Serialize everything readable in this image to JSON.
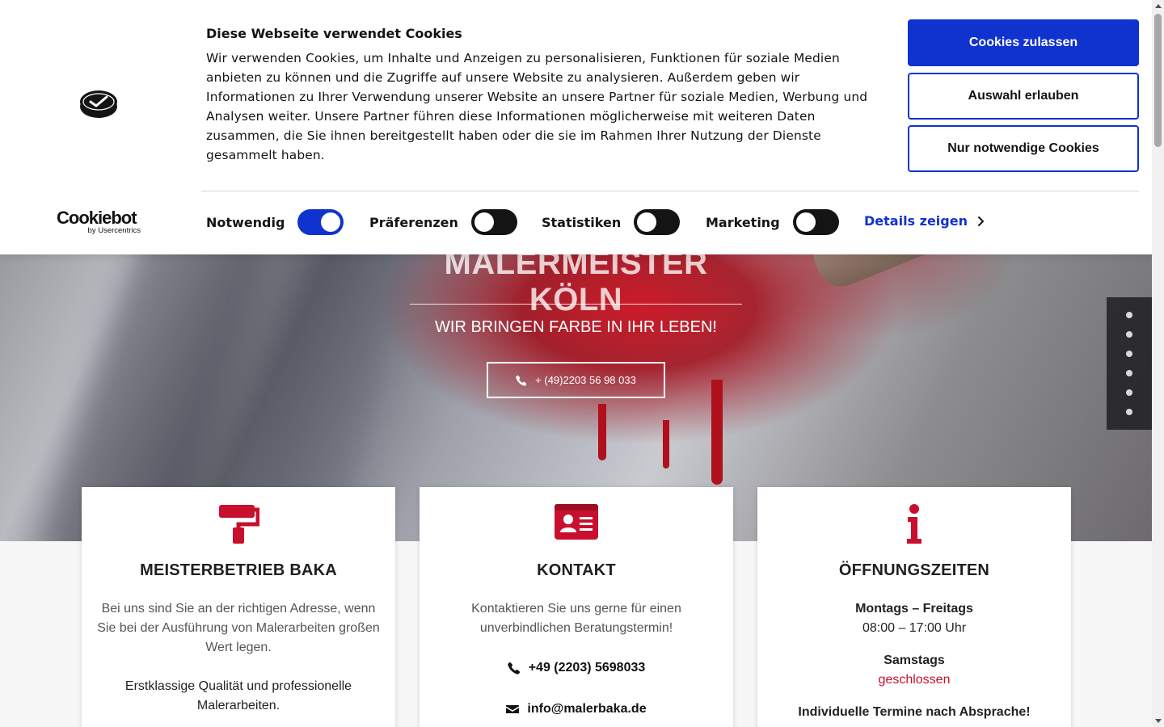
{
  "cookie_banner": {
    "heading": "Diese Webseite verwendet Cookies",
    "text": "Wir verwenden Cookies, um Inhalte und Anzeigen zu personalisieren, Funktionen für soziale Medien anbieten zu können und die Zugriffe auf unsere Website zu analysieren. Außerdem geben wir Informationen zu Ihrer Verwendung unserer Website an unsere Partner für soziale Medien, Werbung und Analysen weiter. Unsere Partner führen diese Informationen möglicherweise mit weiteren Daten zusammen, die Sie ihnen bereitgestellt haben oder die sie im Rahmen Ihrer Nutzung der Dienste gesammelt haben.",
    "brand": "Cookiebot",
    "brand_sub": "by Usercentrics",
    "buttons": {
      "allow_all": "Cookies zulassen",
      "allow_selection": "Auswahl erlauben",
      "necessary_only": "Nur notwendige Cookies"
    },
    "categories": [
      {
        "label": "Notwendig",
        "checked": true
      },
      {
        "label": "Präferenzen",
        "checked": false
      },
      {
        "label": "Statistiken",
        "checked": false
      },
      {
        "label": "Marketing",
        "checked": false
      }
    ],
    "details_link": "Details zeigen",
    "accent_color": "#1032cf"
  },
  "hero": {
    "title": "MALERMEISTER KÖLN",
    "subtitle": "WIR BRINGEN FARBE IN IHR LEBEN!",
    "phone_button": "+ (49)2203 56 98 033",
    "slide_count": 6
  },
  "cards": {
    "about": {
      "icon": "paint-roller-icon",
      "title": "MEISTERBETRIEB BAKA",
      "text": "Bei uns sind Sie an der richtigen Adresse, wenn Sie bei der Ausführung von Malerarbeiten großen Wert legen.",
      "text2": "Erstklassige Qualität und professionelle Malerarbeiten."
    },
    "contact": {
      "icon": "id-card-icon",
      "title": "KONTAKT",
      "text": "Kontaktieren Sie uns gerne für einen unverbindlichen Beratungstermin!",
      "phone": "+49 (2203) 5698033",
      "email": "info@malerbaka.de"
    },
    "hours": {
      "icon": "info-icon",
      "title": "ÖFFNUNGSZEITEN",
      "weekdays_label": "Montags – Freitags",
      "weekdays_time": "08:00 – 17:00 Uhr",
      "saturday_label": "Samstags",
      "saturday_status": "geschlossen",
      "note": "Individuelle Termine nach Absprache!"
    }
  },
  "brand_red": "#c8102e"
}
